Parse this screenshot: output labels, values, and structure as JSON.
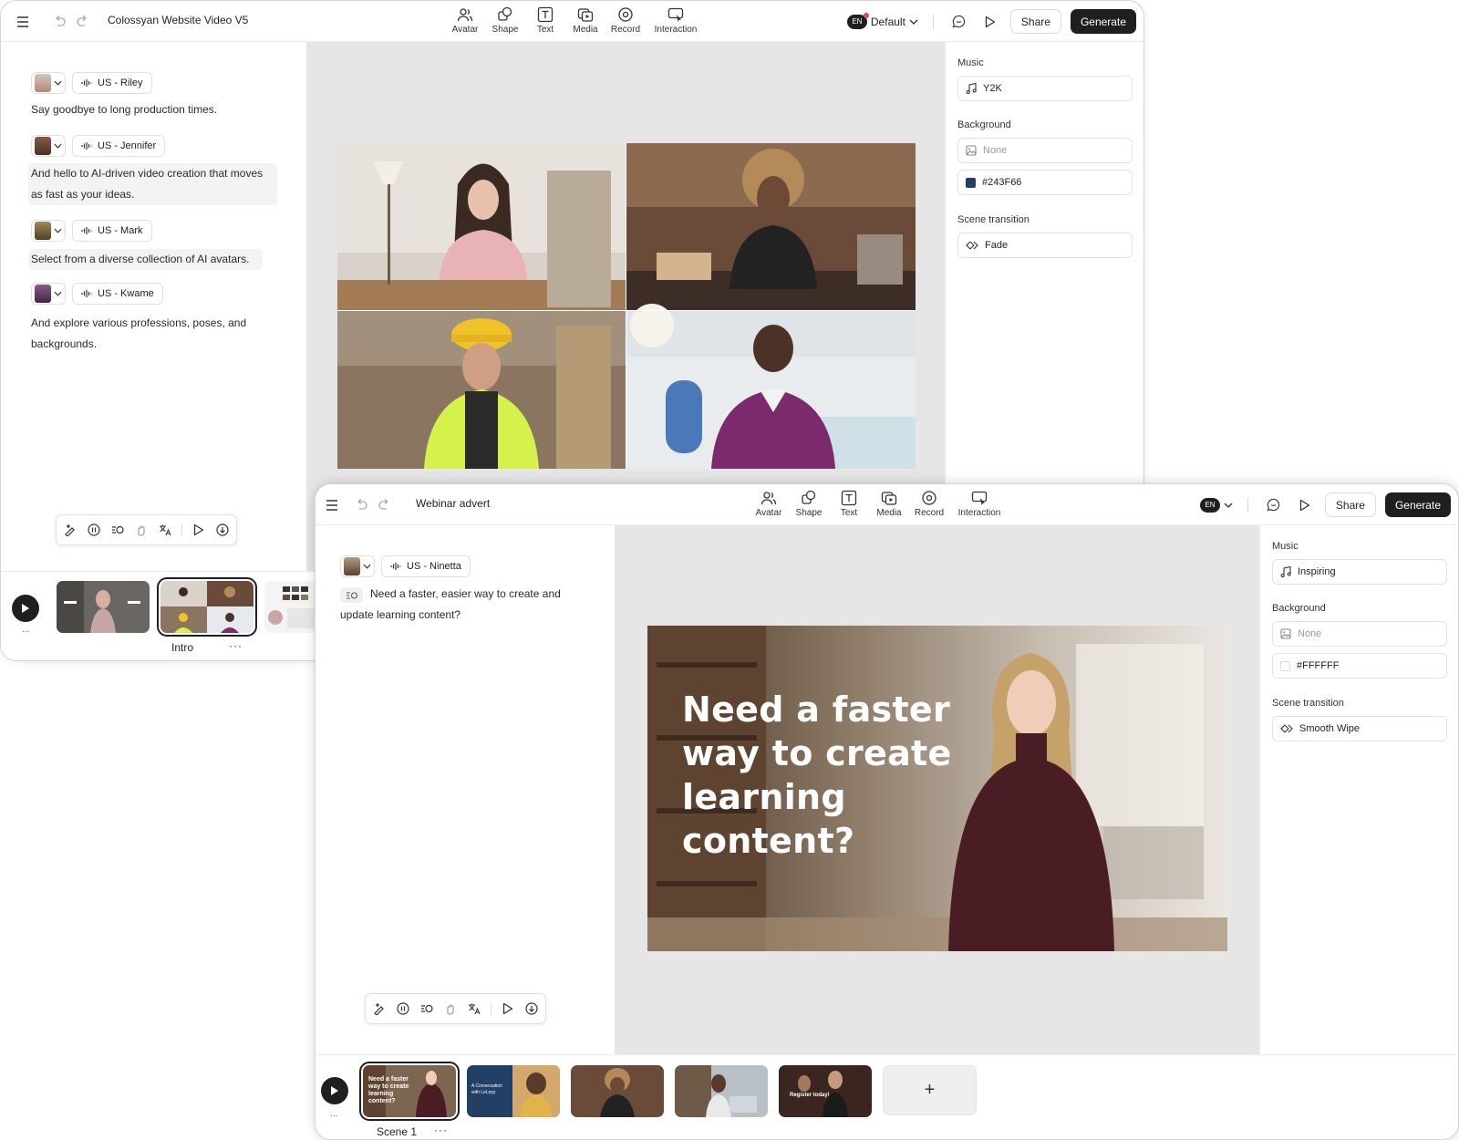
{
  "toolbar_tools": {
    "avatar": "Avatar",
    "shape": "Shape",
    "text": "Text",
    "media": "Media",
    "record": "Record",
    "interaction": "Interaction"
  },
  "window1": {
    "title": "Colossyan Website Video V5",
    "language_badge": "EN",
    "language_label": "Default",
    "share": "Share",
    "generate": "Generate",
    "script": [
      {
        "voice": "US - Riley",
        "text": "Say goodbye to long production times.",
        "avatar_color": "#c9a79b"
      },
      {
        "voice": "US - Jennifer",
        "text": "And hello to AI-driven video creation that moves as fast as your ideas.",
        "avatar_color": "#6b4a3c"
      },
      {
        "voice": "US - Mark",
        "text": "Select from a diverse collection of AI avatars.",
        "avatar_color": "#7d6a3e"
      },
      {
        "voice": "US - Kwame",
        "text": "And explore various professions, poses, and backgrounds.",
        "avatar_color": "#6a3d66"
      }
    ],
    "settings": {
      "music_label": "Music",
      "music_value": "Y2K",
      "background_label": "Background",
      "background_image": "None",
      "background_color": "#243F66",
      "transition_label": "Scene transition",
      "transition_value": "Fade"
    },
    "timeline": {
      "scene_label": "Intro",
      "more": "···",
      "play_dots": "..."
    }
  },
  "window2": {
    "title": "Webinar advert",
    "language_badge": "EN",
    "share": "Share",
    "generate": "Generate",
    "script": [
      {
        "voice": "US - Ninetta",
        "text": "Need a faster, easier way to create and update learning content?",
        "avatar_color": "#8a6a52"
      }
    ],
    "overlay_lines": [
      "Need a faster",
      "way to create",
      "learning",
      "content?"
    ],
    "settings": {
      "music_label": "Music",
      "music_value": "Inspiring",
      "background_label": "Background",
      "background_image": "None",
      "background_color": "#FFFFFF",
      "transition_label": "Scene transition",
      "transition_value": "Smooth Wipe"
    },
    "timeline": {
      "scene_label": "Scene 1",
      "more": "···",
      "play_dots": "...",
      "add": "+",
      "thumb_texts": [
        "Need a faster way to create learning content?",
        "A Conversation with LeLeyy",
        "",
        "",
        "Register today!"
      ]
    }
  }
}
